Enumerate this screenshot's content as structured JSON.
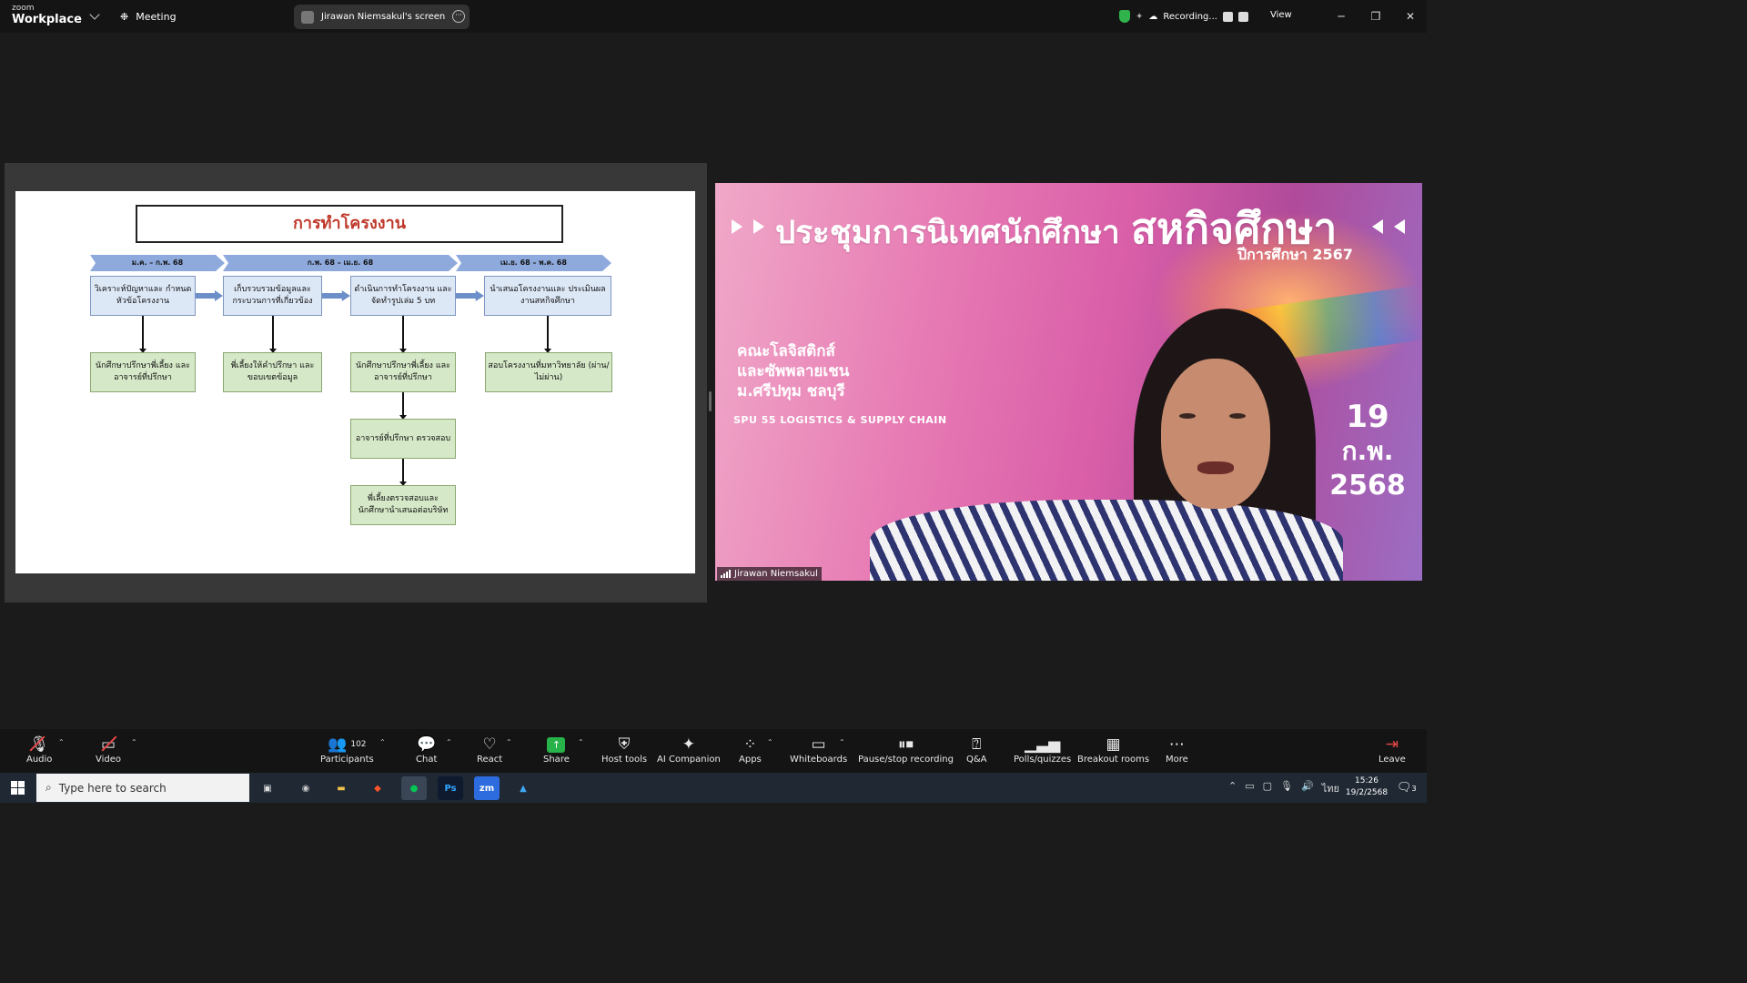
{
  "app": {
    "logo_small": "zoom",
    "logo_large": "Workplace",
    "meeting_label": "Meeting",
    "screen_share_label": "Jirawan Niemsakul's screen",
    "recording_label": "Recording...",
    "view_label": "View"
  },
  "slide": {
    "title": "การทำโครงงาน",
    "phases": [
      "ม.ค. – ก.พ. 68",
      "ก.พ. 68 – เม.ย. 68",
      "เม.ย. 68 – พ.ค. 68"
    ],
    "steps": [
      "วิเคราะห์ปัญหาและ กำหนดหัวข้อโครงงาน",
      "เก็บรวบรวมข้อมูลและ กระบวนการที่เกี่ยวข้อง",
      "ดำเนินการทำโครงงาน และจัดทำรูปเล่ม 5 บท",
      "นำเสนอโครงงานและ ประเมินผลงานสหกิจศึกษา"
    ],
    "results": [
      "นักศึกษาปรึกษาพี่เลี้ยง และอาจารย์ที่ปรึกษา",
      "พี่เลี้ยงให้คำปรึกษา และขอบเขตข้อมูล",
      "นักศึกษาปรึกษาพี่เลี้ยง และอาจารย์ที่ปรึกษา",
      "สอบโครงงานที่มหาวิทยาลัย (ผ่าน/ไม่ผ่าน)"
    ],
    "check1": "อาจารย์ที่ปรึกษา ตรวจสอบ",
    "check2": "พี่เลี้ยงตรวจสอบและ นักศึกษานำเสนอต่อบริษัท"
  },
  "video": {
    "heading_small": "ประชุมการนิเทศนักศึกษา",
    "heading_big": "สหกิจศึกษา",
    "year": "ปีการศึกษา 2567",
    "faculty_line1": "คณะโลจิสติกส์",
    "faculty_line2": "และซัพพลายเชน",
    "faculty_line3": "ม.ศรีปทุม ชลบุรี",
    "logos_text": "SPU 55  LOGISTICS & SUPPLY CHAIN",
    "date_day": "19",
    "date_month": "ก.พ.",
    "date_year": "2568",
    "participant_name": "Jirawan Niemsakul"
  },
  "toolbar": {
    "audio": "Audio",
    "video": "Video",
    "participants": "Participants",
    "participants_count": "102",
    "chat": "Chat",
    "react": "React",
    "share": "Share",
    "host_tools": "Host tools",
    "ai_companion": "AI Companion",
    "apps": "Apps",
    "whiteboards": "Whiteboards",
    "pause_recording": "Pause/stop recording",
    "qa": "Q&A",
    "polls": "Polls/quizzes",
    "breakout": "Breakout rooms",
    "more": "More",
    "leave": "Leave"
  },
  "taskbar": {
    "search_placeholder": "Type here to search",
    "time": "15:26",
    "date": "19/2/2568",
    "lang": "ไทย",
    "notifications": "3"
  },
  "colors": {
    "accent_green": "#27b24a",
    "leave_red": "#e54848",
    "slide_title": "#c0392b"
  }
}
